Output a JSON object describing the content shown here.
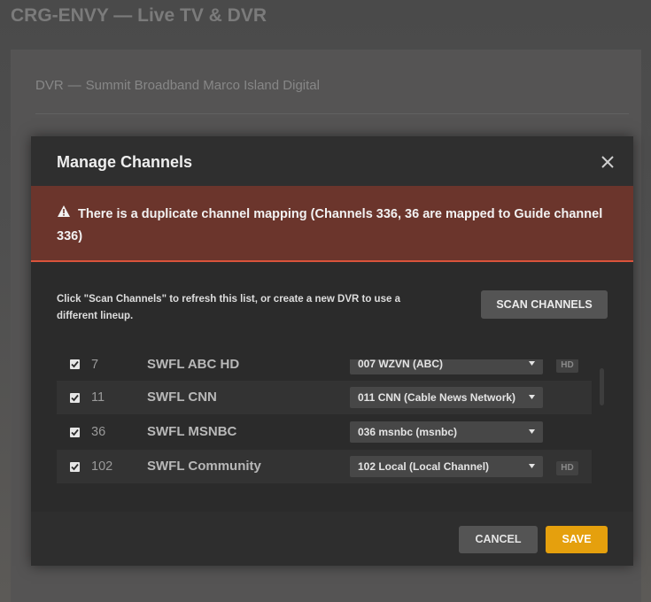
{
  "page": {
    "title": "CRG-ENVY — Live TV & DVR",
    "breadcrumb": {
      "section": "DVR",
      "separator": "—",
      "source": "Summit Broadband Marco Island Digital"
    }
  },
  "modal": {
    "title": "Manage Channels",
    "close_icon": "close-icon",
    "alert": {
      "icon": "warning-icon",
      "text": "There is a duplicate channel mapping (Channels 336, 36 are mapped to Guide channel 336)"
    },
    "helper_text": "Click \"Scan Channels\" to refresh this list, or create a new DVR to use a different lineup.",
    "scan_button": "SCAN CHANNELS",
    "channels": [
      {
        "checked": true,
        "number": "7",
        "name": "SWFL ABC HD",
        "guide": "007 WZVN (ABC)",
        "hd": "HD"
      },
      {
        "checked": true,
        "number": "11",
        "name": "SWFL CNN",
        "guide": "011 CNN (Cable News Network)",
        "hd": ""
      },
      {
        "checked": true,
        "number": "36",
        "name": "SWFL MSNBC",
        "guide": "036 msnbc (msnbc)",
        "hd": ""
      },
      {
        "checked": true,
        "number": "102",
        "name": "SWFL Community",
        "guide": "102 Local (Local Channel)",
        "hd": "HD"
      }
    ],
    "footer": {
      "cancel": "CANCEL",
      "save": "SAVE"
    }
  },
  "colors": {
    "accent": "#e5a00d",
    "alert_bg": "#6b352c",
    "alert_border": "#d9533b",
    "modal_bg": "#2b2b2b"
  }
}
